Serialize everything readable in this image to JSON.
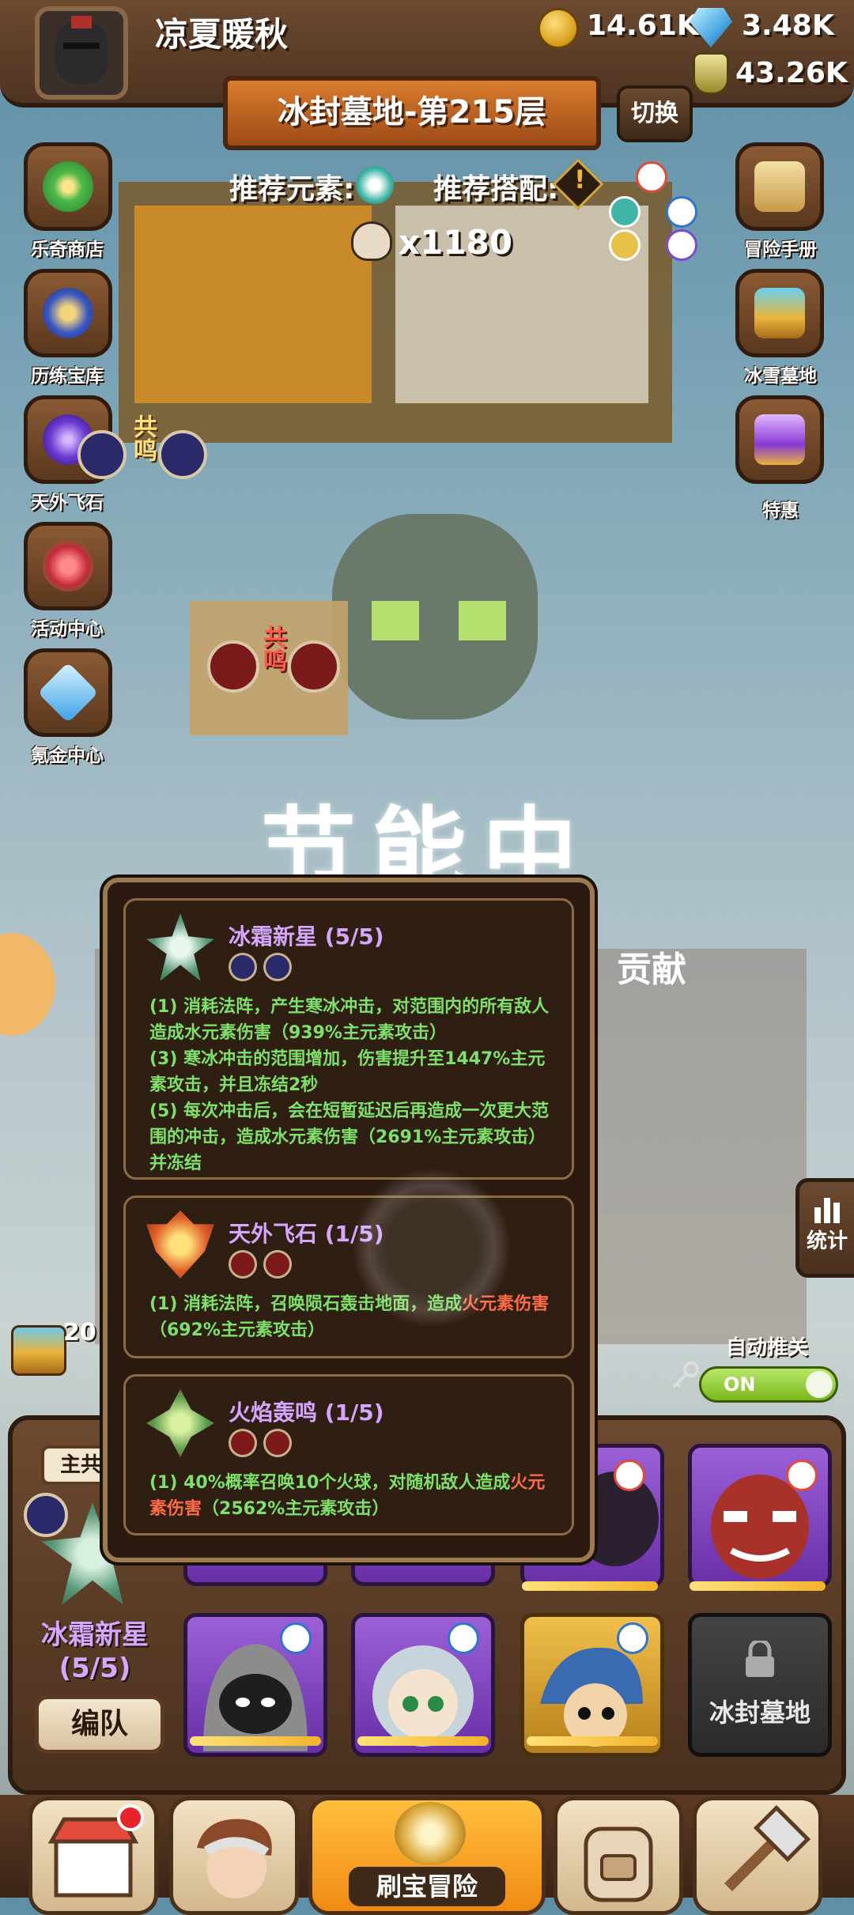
{
  "header": {
    "username": "凉夏暖秋",
    "gold": "14.61K",
    "diamonds": "3.48K",
    "potions": "43.26K"
  },
  "stage": {
    "title": "冰封墓地-第215层",
    "switch_label": "切换",
    "recommend_element_label": "推荐元素:",
    "recommend_combo_label": "推荐搭配:",
    "kill_count": "x1180"
  },
  "left_menu": [
    "乐奇商店",
    "历练宝库",
    "天外飞石",
    "活动中心",
    "氪金中心"
  ],
  "right_menu": [
    "冒险手册",
    "冰雪墓地",
    "特惠"
  ],
  "resonance_label": "共鸣",
  "overlay": {
    "energy_saving": "节能中",
    "contribution": "贡献"
  },
  "stats_button": "统计",
  "auto_recommend": {
    "label": "自动推关",
    "toggle": "ON"
  },
  "chest_count": "20",
  "tooltip": {
    "skills": [
      {
        "name": "冰霜新星 (5/5)",
        "desc": [
          "(1) 消耗法阵，产生寒冰冲击，对范围内的所有敌人造成水元素伤害（939%主元素攻击）",
          "(3) 寒冰冲击的范围增加，伤害提升至1447%主元素攻击，并且冻结2秒",
          "(5) 每次冲击后，会在短暂延迟后再造成一次更大范围的冲击，造成水元素伤害（2691%主元素攻击）并冻结"
        ]
      },
      {
        "name": "天外飞石 (1/5)",
        "desc_a": "(1) 消耗法阵，召唤陨石轰击地面，造成",
        "desc_fire": "火元素伤害",
        "desc_b": "（692%主元素攻击）"
      },
      {
        "name": "火焰轰鸣 (1/5)",
        "desc_a": "(1) 40%概率召唤10个火球，对随机敌人造成",
        "desc_fire": "火元素伤害",
        "desc_b": "（2562%主元素攻击）"
      }
    ]
  },
  "team": {
    "tab_label": "主共",
    "main_skill": "冰霜新星",
    "main_skill_level": "(5/5)",
    "formation_button": "编队",
    "locked_slot_label": "冰封墓地"
  },
  "bottom_nav": {
    "active_label": "刷宝冒险"
  },
  "colors": {
    "accent_orange": "#f08a12",
    "skill_name_purple": "#d6a6ff",
    "desc_green": "#7ee06a",
    "fire_red": "#ff6b4a",
    "toggle_green": "#9fdc3a"
  }
}
